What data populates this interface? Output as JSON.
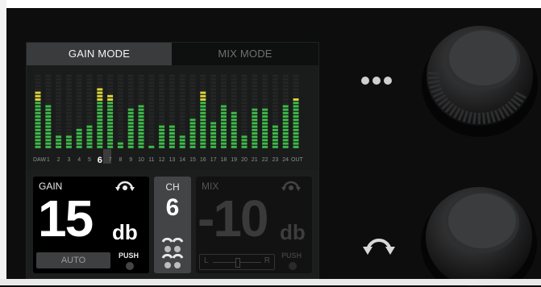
{
  "tabs": {
    "gain_mode": "GAIN MODE",
    "mix_mode": "MIX MODE"
  },
  "meters": {
    "channel_labels": [
      "DAW",
      "1",
      "2",
      "3",
      "4",
      "5",
      "6",
      "7",
      "8",
      "9",
      "10",
      "11",
      "12",
      "13",
      "14",
      "15",
      "16",
      "17",
      "18",
      "19",
      "20",
      "21",
      "22",
      "23",
      "24",
      "OUT"
    ],
    "selected_channel": "6",
    "levels": [
      0.75,
      0.6,
      0.16,
      0.16,
      0.28,
      0.32,
      0.82,
      0.73,
      0.1,
      0.55,
      0.6,
      0.05,
      0.33,
      0.3,
      0.19,
      0.4,
      0.75,
      0.38,
      0.6,
      0.5,
      0.2,
      0.55,
      0.55,
      0.3,
      0.6,
      0.68
    ],
    "colors": {
      "green": "#3fb84a",
      "yellow": "#d9d23a",
      "orange": "#e9822c",
      "unlit": "#242525"
    }
  },
  "gain": {
    "label": "GAIN",
    "value": "15",
    "unit": "db",
    "auto_button": "AUTO",
    "push": "PUSH"
  },
  "channel": {
    "label": "CH",
    "value": "6"
  },
  "mix": {
    "label": "MIX",
    "value": "-10",
    "unit": "db",
    "left": "L",
    "right": "R",
    "push": "PUSH"
  },
  "icons": {
    "more": "more-dots-icon",
    "undo": "undo-arrows-icon"
  }
}
